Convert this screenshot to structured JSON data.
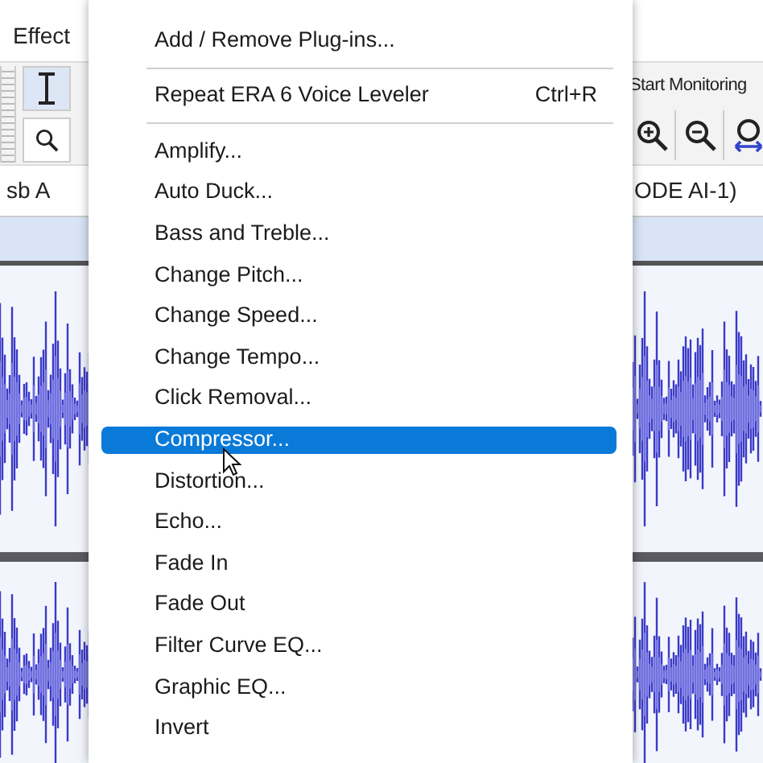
{
  "menubar": {
    "label": "Effect"
  },
  "toolbar": {
    "monitor_label": "Start Monitoring"
  },
  "track_labels": [
    "sb A",
    "ODE AI-1)"
  ],
  "menu": {
    "items": [
      {
        "kind": "item",
        "label": "Add / Remove Plug-ins...",
        "selected": false
      },
      {
        "kind": "separator"
      },
      {
        "kind": "item",
        "label": "Repeat ERA 6 Voice Leveler",
        "shortcut": "Ctrl+R",
        "selected": false
      },
      {
        "kind": "separator"
      },
      {
        "kind": "item",
        "label": "Amplify...",
        "selected": false
      },
      {
        "kind": "item",
        "label": "Auto Duck...",
        "selected": false
      },
      {
        "kind": "item",
        "label": "Bass and Treble...",
        "selected": false
      },
      {
        "kind": "item",
        "label": "Change Pitch...",
        "selected": false
      },
      {
        "kind": "item",
        "label": "Change Speed...",
        "selected": false
      },
      {
        "kind": "item",
        "label": "Change Tempo...",
        "selected": false
      },
      {
        "kind": "item",
        "label": "Click Removal...",
        "selected": false
      },
      {
        "kind": "item",
        "label": "Compressor...",
        "selected": true
      },
      {
        "kind": "item",
        "label": "Distortion...",
        "selected": false
      },
      {
        "kind": "item",
        "label": "Echo...",
        "selected": false
      },
      {
        "kind": "item",
        "label": "Fade In",
        "selected": false
      },
      {
        "kind": "item",
        "label": "Fade Out",
        "selected": false
      },
      {
        "kind": "item",
        "label": "Filter Curve EQ...",
        "selected": false
      },
      {
        "kind": "item",
        "label": "Graphic EQ...",
        "selected": false
      },
      {
        "kind": "item",
        "label": "Invert",
        "selected": false
      }
    ]
  }
}
